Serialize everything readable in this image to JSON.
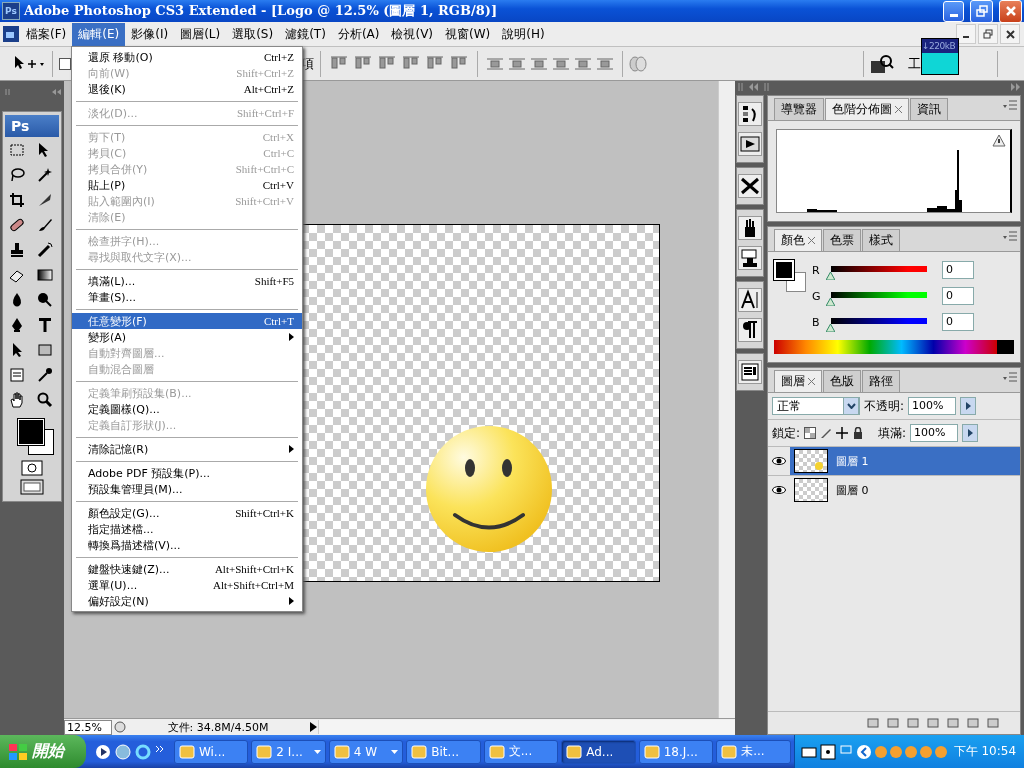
{
  "window": {
    "app_icon": "Ps",
    "title": "Adobe Photoshop CS3 Extended - [Logo @ 12.5% (圖層 1, RGB/8)]"
  },
  "toolbox": {
    "logo": "Ps"
  },
  "menubar": {
    "items": [
      {
        "label": "檔案(F)",
        "selected": false
      },
      {
        "label": "編輯(E)",
        "selected": true
      },
      {
        "label": "影像(I)",
        "selected": false
      },
      {
        "label": "圖層(L)",
        "selected": false
      },
      {
        "label": "選取(S)",
        "selected": false
      },
      {
        "label": "濾鏡(T)",
        "selected": false
      },
      {
        "label": "分析(A)",
        "selected": false
      },
      {
        "label": "檢視(V)",
        "selected": false
      },
      {
        "label": "視窗(W)",
        "selected": false
      },
      {
        "label": "說明(H)",
        "selected": false
      }
    ]
  },
  "options_bar": {
    "partial_label": "項",
    "workspace_label": "工",
    "net_meter": "↓220kB"
  },
  "edit_menu": {
    "items": [
      {
        "kind": "item",
        "label": "還原 移動(O)",
        "shortcut": "Ctrl+Z",
        "disabled": false,
        "selected": false,
        "submenu": false
      },
      {
        "kind": "item",
        "label": "向前(W)",
        "shortcut": "Shift+Ctrl+Z",
        "disabled": true,
        "selected": false,
        "submenu": false
      },
      {
        "kind": "item",
        "label": "退後(K)",
        "shortcut": "Alt+Ctrl+Z",
        "disabled": false,
        "selected": false,
        "submenu": false
      },
      {
        "kind": "separator"
      },
      {
        "kind": "item",
        "label": "淡化(D)...",
        "shortcut": "Shift+Ctrl+F",
        "disabled": true,
        "selected": false,
        "submenu": false
      },
      {
        "kind": "separator"
      },
      {
        "kind": "item",
        "label": "剪下(T)",
        "shortcut": "Ctrl+X",
        "disabled": true,
        "selected": false,
        "submenu": false
      },
      {
        "kind": "item",
        "label": "拷貝(C)",
        "shortcut": "Ctrl+C",
        "disabled": true,
        "selected": false,
        "submenu": false
      },
      {
        "kind": "item",
        "label": "拷貝合併(Y)",
        "shortcut": "Shift+Ctrl+C",
        "disabled": true,
        "selected": false,
        "submenu": false
      },
      {
        "kind": "item",
        "label": "貼上(P)",
        "shortcut": "Ctrl+V",
        "disabled": false,
        "selected": false,
        "submenu": false
      },
      {
        "kind": "item",
        "label": "貼入範圍內(I)",
        "shortcut": "Shift+Ctrl+V",
        "disabled": true,
        "selected": false,
        "submenu": false
      },
      {
        "kind": "item",
        "label": "清除(E)",
        "disabled": true,
        "selected": false,
        "submenu": false
      },
      {
        "kind": "separator"
      },
      {
        "kind": "item",
        "label": "檢查拼字(H)...",
        "disabled": true,
        "selected": false,
        "submenu": false
      },
      {
        "kind": "item",
        "label": "尋找與取代文字(X)...",
        "disabled": true,
        "selected": false,
        "submenu": false
      },
      {
        "kind": "separator"
      },
      {
        "kind": "item",
        "label": "填滿(L)...",
        "shortcut": "Shift+F5",
        "disabled": false,
        "selected": false,
        "submenu": false
      },
      {
        "kind": "item",
        "label": "筆畫(S)...",
        "disabled": false,
        "selected": false,
        "submenu": false
      },
      {
        "kind": "separator"
      },
      {
        "kind": "item",
        "label": "任意變形(F)",
        "shortcut": "Ctrl+T",
        "disabled": false,
        "selected": true,
        "submenu": false
      },
      {
        "kind": "item",
        "label": "變形(A)",
        "disabled": false,
        "selected": false,
        "submenu": true
      },
      {
        "kind": "item",
        "label": "自動對齊圖層...",
        "disabled": true,
        "selected": false,
        "submenu": false
      },
      {
        "kind": "item",
        "label": "自動混合圖層",
        "disabled": true,
        "selected": false,
        "submenu": false
      },
      {
        "kind": "separator"
      },
      {
        "kind": "item",
        "label": "定義筆刷預設集(B)...",
        "disabled": true,
        "selected": false,
        "submenu": false
      },
      {
        "kind": "item",
        "label": "定義圖樣(Q)...",
        "disabled": false,
        "selected": false,
        "submenu": false
      },
      {
        "kind": "item",
        "label": "定義自訂形狀(J)...",
        "disabled": true,
        "selected": false,
        "submenu": false
      },
      {
        "kind": "separator"
      },
      {
        "kind": "item",
        "label": "清除記憶(R)",
        "disabled": false,
        "selected": false,
        "submenu": true
      },
      {
        "kind": "separator"
      },
      {
        "kind": "item",
        "label": "Adobe PDF 預設集(P)...",
        "disabled": false,
        "selected": false,
        "submenu": false
      },
      {
        "kind": "item",
        "label": "預設集管理員(M)...",
        "disabled": false,
        "selected": false,
        "submenu": false
      },
      {
        "kind": "separator"
      },
      {
        "kind": "item",
        "label": "顏色設定(G)...",
        "shortcut": "Shift+Ctrl+K",
        "disabled": false,
        "selected": false,
        "submenu": false
      },
      {
        "kind": "item",
        "label": "指定描述檔...",
        "disabled": false,
        "selected": false,
        "submenu": false
      },
      {
        "kind": "item",
        "label": "轉換爲描述檔(V)...",
        "disabled": false,
        "selected": false,
        "submenu": false
      },
      {
        "kind": "separator"
      },
      {
        "kind": "item",
        "label": "鍵盤快速鍵(Z)...",
        "shortcut": "Alt+Shift+Ctrl+K",
        "disabled": false,
        "selected": false,
        "submenu": false
      },
      {
        "kind": "item",
        "label": "選單(U)...",
        "shortcut": "Alt+Shift+Ctrl+M",
        "disabled": false,
        "selected": false,
        "submenu": false
      },
      {
        "kind": "item",
        "label": "偏好設定(N)",
        "disabled": false,
        "selected": false,
        "submenu": true
      }
    ]
  },
  "status_bar": {
    "zoom": "12.5%",
    "document_info": "文件: 34.8M/4.50M"
  },
  "histogram_panel": {
    "tabs": [
      {
        "label": "導覽器",
        "selected": false
      },
      {
        "label": "色階分佈圖",
        "selected": true
      },
      {
        "label": "資訊",
        "selected": false
      }
    ]
  },
  "color_panel": {
    "tabs": [
      {
        "label": "顏色",
        "selected": true
      },
      {
        "label": "色票",
        "selected": false
      },
      {
        "label": "樣式",
        "selected": false
      }
    ],
    "channels": [
      {
        "label": "R",
        "color": "#ff0000",
        "level": 0,
        "value": "0"
      },
      {
        "label": "G",
        "color": "#00ff00",
        "level": 0,
        "value": "0"
      },
      {
        "label": "B",
        "color": "#0000ff",
        "level": 0,
        "value": "0"
      }
    ]
  },
  "layers_panel": {
    "tabs": [
      {
        "label": "圖層",
        "selected": true
      },
      {
        "label": "色版",
        "selected": false
      },
      {
        "label": "路徑",
        "selected": false
      }
    ],
    "blend_mode": "正常",
    "opacity_label": "不透明:",
    "opacity": "100%",
    "lock_label": "鎖定:",
    "fill_label": "填滿:",
    "fill": "100%",
    "layers": [
      {
        "name": "圖層 1",
        "selected": true,
        "visible": true,
        "kind": "smiley"
      },
      {
        "name": "圖層 0",
        "selected": false,
        "visible": true,
        "kind": "empty"
      }
    ]
  },
  "taskbar": {
    "start": "開始",
    "tasks": [
      {
        "label": "Wi...",
        "grouped": false,
        "selected": false
      },
      {
        "label": "2 I...",
        "grouped": true,
        "selected": false
      },
      {
        "label": "4 W",
        "grouped": true,
        "selected": false
      },
      {
        "label": "Bit...",
        "grouped": false,
        "selected": false
      },
      {
        "label": "文...",
        "grouped": false,
        "selected": false
      },
      {
        "label": "Ad...",
        "grouped": false,
        "selected": true
      },
      {
        "label": "18.J...",
        "grouped": false,
        "selected": false
      },
      {
        "label": "未...",
        "grouped": false,
        "selected": false
      }
    ],
    "clock": "下午 10:54"
  }
}
